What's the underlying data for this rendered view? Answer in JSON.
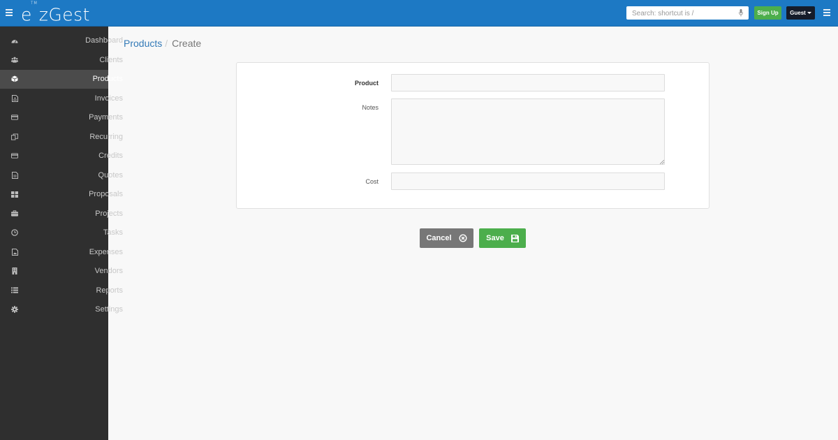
{
  "header": {
    "logo_text": "ezGest",
    "logo_sup": "TM",
    "search_placeholder": "Search: shortcut is /",
    "signup_label": "Sign Up",
    "guest_label": "Guest"
  },
  "sidebar": {
    "items": [
      {
        "label": "Dashboard",
        "icon": "dashboard-icon"
      },
      {
        "label": "Clients",
        "icon": "users-icon"
      },
      {
        "label": "Products",
        "icon": "cube-icon",
        "active": true
      },
      {
        "label": "Invoices",
        "icon": "file-pdf-icon"
      },
      {
        "label": "Payments",
        "icon": "credit-card-icon"
      },
      {
        "label": "Recurring",
        "icon": "files-icon"
      },
      {
        "label": "Credits",
        "icon": "credit-card-icon"
      },
      {
        "label": "Quotes",
        "icon": "file-text-icon"
      },
      {
        "label": "Proposals",
        "icon": "th-large-icon"
      },
      {
        "label": "Projects",
        "icon": "briefcase-icon"
      },
      {
        "label": "Tasks",
        "icon": "clock-icon"
      },
      {
        "label": "Expenses",
        "icon": "file-image-icon"
      },
      {
        "label": "Vendors",
        "icon": "building-icon"
      },
      {
        "label": "Reports",
        "icon": "list-icon"
      },
      {
        "label": "Settings",
        "icon": "cog-icon"
      }
    ]
  },
  "breadcrumb": {
    "parent": "Products",
    "separator": "/",
    "current": "Create"
  },
  "form": {
    "product_label": "Product",
    "product_value": "",
    "notes_label": "Notes",
    "notes_value": "",
    "cost_label": "Cost",
    "cost_value": ""
  },
  "actions": {
    "cancel_label": "Cancel",
    "save_label": "Save"
  },
  "colors": {
    "header_bg": "#1d79c4",
    "sidebar_bg": "#2f2f2f",
    "sidebar_active": "#4b4b4b",
    "signup_green": "#4cae4c",
    "guest_navy": "#151c2a",
    "link_blue": "#337ab7",
    "cancel_gray": "#777777"
  }
}
